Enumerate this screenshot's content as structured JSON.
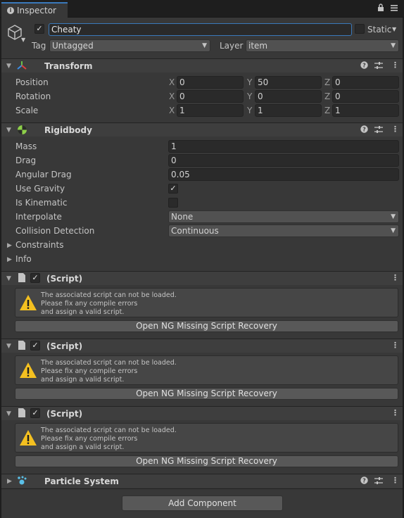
{
  "tab": {
    "title": "Inspector",
    "lock_icon": "lock-icon",
    "menu_icon": "kebab-menu-icon"
  },
  "header": {
    "active": true,
    "name": "Cheaty",
    "static_label": "Static",
    "static_checked": false,
    "tag_label": "Tag",
    "tag_value": "Untagged",
    "layer_label": "Layer",
    "layer_value": "item"
  },
  "transform": {
    "title": "Transform",
    "rows": [
      {
        "label": "Position",
        "x": "0",
        "y": "50",
        "z": "0"
      },
      {
        "label": "Rotation",
        "x": "0",
        "y": "0",
        "z": "0"
      },
      {
        "label": "Scale",
        "x": "1",
        "y": "1",
        "z": "1"
      }
    ],
    "axes": [
      "X",
      "Y",
      "Z"
    ]
  },
  "rigidbody": {
    "title": "Rigidbody",
    "mass_label": "Mass",
    "mass": "1",
    "drag_label": "Drag",
    "drag": "0",
    "angular_drag_label": "Angular Drag",
    "angular_drag": "0.05",
    "use_gravity_label": "Use Gravity",
    "use_gravity": true,
    "is_kinematic_label": "Is Kinematic",
    "is_kinematic": false,
    "interpolate_label": "Interpolate",
    "interpolate": "None",
    "collision_label": "Collision Detection",
    "collision": "Continuous",
    "constraints_label": "Constraints",
    "info_label": "Info"
  },
  "scripts": [
    {
      "title": "(Script)",
      "message": "The associated script can not be loaded.\nPlease fix any compile errors\nand assign a valid script.",
      "button": "Open NG Missing Script Recovery"
    },
    {
      "title": "(Script)",
      "message": "The associated script can not be loaded.\nPlease fix any compile errors\nand assign a valid script.",
      "button": "Open NG Missing Script Recovery"
    },
    {
      "title": "(Script)",
      "message": "The associated script can not be loaded.\nPlease fix any compile errors\nand assign a valid script.",
      "button": "Open NG Missing Script Recovery"
    }
  ],
  "particle_system": {
    "title": "Particle System"
  },
  "add_component": "Add Component",
  "colors": {
    "accent": "#3a79bb",
    "panel": "#383838",
    "warning": "#f4c020"
  }
}
